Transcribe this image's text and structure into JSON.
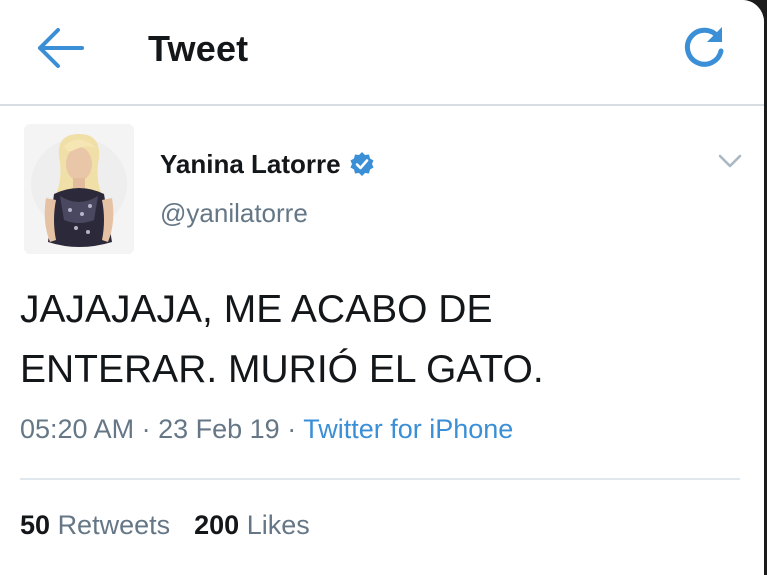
{
  "header": {
    "back_icon": "arrow-left-icon",
    "title": "Tweet",
    "refresh_icon": "refresh-icon",
    "accent": "#3b8fd6"
  },
  "tweet": {
    "author": {
      "name": "Yanina Latorre",
      "verified_icon": "verified-badge-icon",
      "handle": "@yanilatorre"
    },
    "menu_icon": "chevron-down-icon",
    "text": "JAJAJAJA, ME ACABO DE\nENTERAR. MURIÓ EL GATO.",
    "time": "05:20 AM",
    "separator": "·",
    "date": "23 Feb 19",
    "source": "Twitter for iPhone",
    "retweets_count": "50",
    "retweets_label": "Retweets",
    "likes_count": "200",
    "likes_label": "Likes"
  },
  "colors": {
    "text_primary": "#14171a",
    "text_secondary": "#657786",
    "link": "#3b8fd6",
    "divider": "#e1e8ed"
  }
}
